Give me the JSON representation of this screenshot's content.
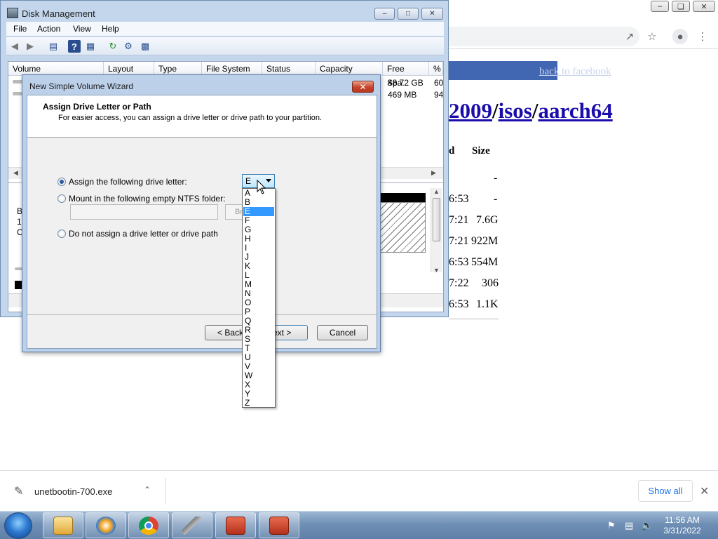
{
  "browser": {
    "back_link": "back to facebook",
    "heading_parts": [
      "2009",
      "/",
      "isos",
      "/",
      "aarch64"
    ],
    "list_header": {
      "col_d": "d",
      "size": "Size"
    },
    "rows": [
      {
        "date": "",
        "size": "-"
      },
      {
        "date": "6:53",
        "size": "-"
      },
      {
        "date": "7:21",
        "size": "7.6G"
      },
      {
        "date": "7:21",
        "size": "922M"
      },
      {
        "date": "6:53",
        "size": "554M"
      },
      {
        "date": "7:22",
        "size": "306"
      },
      {
        "date": "6:53",
        "size": "1.1K"
      }
    ],
    "titlebar_buttons": [
      "minimize",
      "restore",
      "close"
    ]
  },
  "downloads": {
    "file_name": "unetbootin-700.exe",
    "show_all": "Show all"
  },
  "taskbar": {
    "time": "11:56 AM",
    "date": "3/31/2022",
    "apps": [
      "explorer-icon",
      "media-player-icon",
      "chrome-icon",
      "unetbootin-icon",
      "disk-management-icon",
      "disk-management-icon"
    ]
  },
  "disk_management": {
    "title": "Disk Management",
    "menu": [
      "File",
      "Action",
      "View",
      "Help"
    ],
    "columns": [
      "Volume",
      "Layout",
      "Type",
      "File System",
      "Status",
      "Capacity",
      "Free Spa...",
      "%"
    ],
    "rows": [
      {
        "free": "48.72 GB",
        "pct": "60"
      },
      {
        "free": "469 MB",
        "pct": "94"
      }
    ],
    "left_labels": [
      "B",
      "1",
      "C"
    ]
  },
  "wizard": {
    "title": "New Simple Volume Wizard",
    "heading": "Assign Drive Letter or Path",
    "subheading": "For easier access, you can assign a drive letter or drive path to your partition.",
    "options": [
      {
        "label": "Assign the following drive letter:",
        "selected": true
      },
      {
        "label": "Mount in the following empty NTFS folder:",
        "selected": false
      },
      {
        "label": "Do not assign a drive letter or drive path",
        "selected": false
      }
    ],
    "browse_label": "Browse...",
    "browse_visible": "Bro",
    "selected_letter": "E",
    "letters": [
      "A",
      "B",
      "E",
      "F",
      "G",
      "H",
      "I",
      "J",
      "K",
      "L",
      "M",
      "N",
      "O",
      "P",
      "Q",
      "R",
      "S",
      "T",
      "U",
      "V",
      "W",
      "X",
      "Y",
      "Z"
    ],
    "back_button": "< Back",
    "next_button": "Next >",
    "next_visible": "ext >",
    "cancel_button": "Cancel"
  }
}
